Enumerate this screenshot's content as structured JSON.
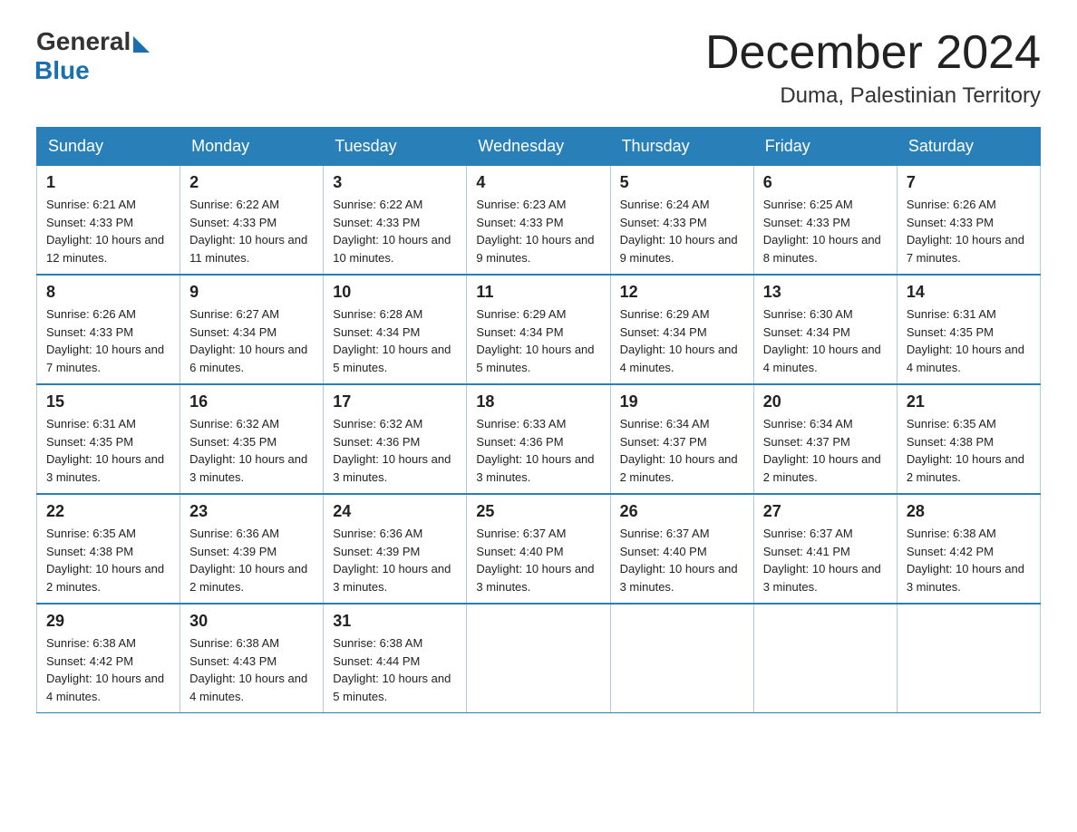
{
  "logo": {
    "general": "General",
    "blue": "Blue"
  },
  "title": "December 2024",
  "location": "Duma, Palestinian Territory",
  "weekdays": [
    "Sunday",
    "Monday",
    "Tuesday",
    "Wednesday",
    "Thursday",
    "Friday",
    "Saturday"
  ],
  "weeks": [
    [
      {
        "date": "1",
        "sunrise": "6:21 AM",
        "sunset": "4:33 PM",
        "daylight": "10 hours and 12 minutes."
      },
      {
        "date": "2",
        "sunrise": "6:22 AM",
        "sunset": "4:33 PM",
        "daylight": "10 hours and 11 minutes."
      },
      {
        "date": "3",
        "sunrise": "6:22 AM",
        "sunset": "4:33 PM",
        "daylight": "10 hours and 10 minutes."
      },
      {
        "date": "4",
        "sunrise": "6:23 AM",
        "sunset": "4:33 PM",
        "daylight": "10 hours and 9 minutes."
      },
      {
        "date": "5",
        "sunrise": "6:24 AM",
        "sunset": "4:33 PM",
        "daylight": "10 hours and 9 minutes."
      },
      {
        "date": "6",
        "sunrise": "6:25 AM",
        "sunset": "4:33 PM",
        "daylight": "10 hours and 8 minutes."
      },
      {
        "date": "7",
        "sunrise": "6:26 AM",
        "sunset": "4:33 PM",
        "daylight": "10 hours and 7 minutes."
      }
    ],
    [
      {
        "date": "8",
        "sunrise": "6:26 AM",
        "sunset": "4:33 PM",
        "daylight": "10 hours and 7 minutes."
      },
      {
        "date": "9",
        "sunrise": "6:27 AM",
        "sunset": "4:34 PM",
        "daylight": "10 hours and 6 minutes."
      },
      {
        "date": "10",
        "sunrise": "6:28 AM",
        "sunset": "4:34 PM",
        "daylight": "10 hours and 5 minutes."
      },
      {
        "date": "11",
        "sunrise": "6:29 AM",
        "sunset": "4:34 PM",
        "daylight": "10 hours and 5 minutes."
      },
      {
        "date": "12",
        "sunrise": "6:29 AM",
        "sunset": "4:34 PM",
        "daylight": "10 hours and 4 minutes."
      },
      {
        "date": "13",
        "sunrise": "6:30 AM",
        "sunset": "4:34 PM",
        "daylight": "10 hours and 4 minutes."
      },
      {
        "date": "14",
        "sunrise": "6:31 AM",
        "sunset": "4:35 PM",
        "daylight": "10 hours and 4 minutes."
      }
    ],
    [
      {
        "date": "15",
        "sunrise": "6:31 AM",
        "sunset": "4:35 PM",
        "daylight": "10 hours and 3 minutes."
      },
      {
        "date": "16",
        "sunrise": "6:32 AM",
        "sunset": "4:35 PM",
        "daylight": "10 hours and 3 minutes."
      },
      {
        "date": "17",
        "sunrise": "6:32 AM",
        "sunset": "4:36 PM",
        "daylight": "10 hours and 3 minutes."
      },
      {
        "date": "18",
        "sunrise": "6:33 AM",
        "sunset": "4:36 PM",
        "daylight": "10 hours and 3 minutes."
      },
      {
        "date": "19",
        "sunrise": "6:34 AM",
        "sunset": "4:37 PM",
        "daylight": "10 hours and 2 minutes."
      },
      {
        "date": "20",
        "sunrise": "6:34 AM",
        "sunset": "4:37 PM",
        "daylight": "10 hours and 2 minutes."
      },
      {
        "date": "21",
        "sunrise": "6:35 AM",
        "sunset": "4:38 PM",
        "daylight": "10 hours and 2 minutes."
      }
    ],
    [
      {
        "date": "22",
        "sunrise": "6:35 AM",
        "sunset": "4:38 PM",
        "daylight": "10 hours and 2 minutes."
      },
      {
        "date": "23",
        "sunrise": "6:36 AM",
        "sunset": "4:39 PM",
        "daylight": "10 hours and 2 minutes."
      },
      {
        "date": "24",
        "sunrise": "6:36 AM",
        "sunset": "4:39 PM",
        "daylight": "10 hours and 3 minutes."
      },
      {
        "date": "25",
        "sunrise": "6:37 AM",
        "sunset": "4:40 PM",
        "daylight": "10 hours and 3 minutes."
      },
      {
        "date": "26",
        "sunrise": "6:37 AM",
        "sunset": "4:40 PM",
        "daylight": "10 hours and 3 minutes."
      },
      {
        "date": "27",
        "sunrise": "6:37 AM",
        "sunset": "4:41 PM",
        "daylight": "10 hours and 3 minutes."
      },
      {
        "date": "28",
        "sunrise": "6:38 AM",
        "sunset": "4:42 PM",
        "daylight": "10 hours and 3 minutes."
      }
    ],
    [
      {
        "date": "29",
        "sunrise": "6:38 AM",
        "sunset": "4:42 PM",
        "daylight": "10 hours and 4 minutes."
      },
      {
        "date": "30",
        "sunrise": "6:38 AM",
        "sunset": "4:43 PM",
        "daylight": "10 hours and 4 minutes."
      },
      {
        "date": "31",
        "sunrise": "6:38 AM",
        "sunset": "4:44 PM",
        "daylight": "10 hours and 5 minutes."
      },
      null,
      null,
      null,
      null
    ]
  ],
  "labels": {
    "sunrise": "Sunrise:",
    "sunset": "Sunset:",
    "daylight": "Daylight:"
  }
}
